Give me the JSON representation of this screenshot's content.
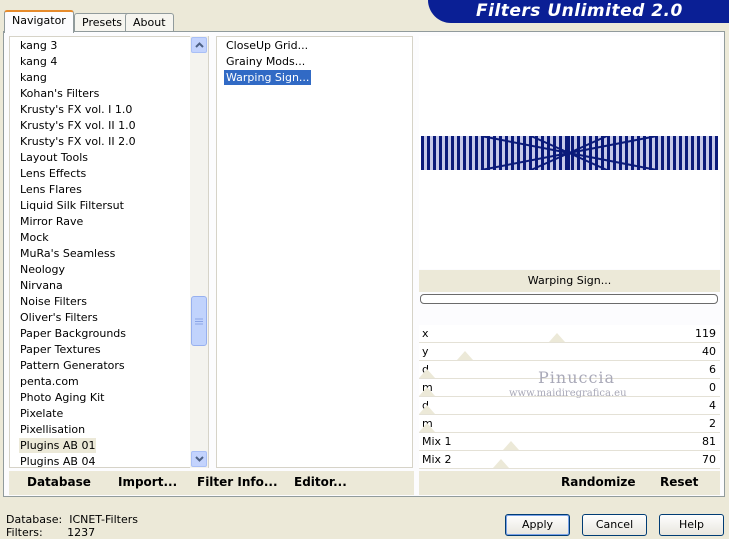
{
  "tabs": [
    "Navigator",
    "Presets",
    "About"
  ],
  "title": "Filters Unlimited 2.0",
  "categories": [
    "kang 3",
    "kang 4",
    "kang",
    "Kohan's Filters",
    "Krusty's FX vol. I 1.0",
    "Krusty's FX vol. II 1.0",
    "Krusty's FX vol. II 2.0",
    "Layout Tools",
    "Lens Effects",
    "Lens Flares",
    "Liquid Silk Filtersut",
    "Mirror Rave",
    "Mock",
    "MuRa's Seamless",
    "Neology",
    "Nirvana",
    "Noise Filters",
    "Oliver's Filters",
    "Paper Backgrounds",
    "Paper Textures",
    "Pattern Generators",
    "penta.com",
    "Photo Aging Kit",
    "Pixelate",
    "Pixellisation",
    "Plugins AB 01",
    "Plugins AB 04"
  ],
  "selected_category": "Plugins AB 01",
  "filters": [
    "CloseUp Grid...",
    "Grainy Mods...",
    "Warping Sign..."
  ],
  "selected_filter": "Warping Sign...",
  "current_filter_name": "Warping Sign...",
  "params": [
    {
      "label": "x",
      "value": "119"
    },
    {
      "label": "y",
      "value": "40"
    },
    {
      "label": "d",
      "value": "6"
    },
    {
      "label": "m",
      "value": "0"
    },
    {
      "label": "d",
      "value": "4"
    },
    {
      "label": "m",
      "value": "2"
    },
    {
      "label": "Mix 1",
      "value": "81"
    },
    {
      "label": "Mix 2",
      "value": "70"
    }
  ],
  "watermark": {
    "line1": "Pinuccia",
    "line2": "www.maidiregrafica.eu"
  },
  "toolbar_left": {
    "database": "Database",
    "import": "Import...",
    "filter_info": "Filter Info...",
    "editor": "Editor..."
  },
  "toolbar_right": {
    "randomize": "Randomize",
    "reset": "Reset"
  },
  "status": {
    "database_label": "Database:",
    "database_value": "ICNET-Filters",
    "filters_label": "Filters:",
    "filters_value": "1237"
  },
  "buttons": {
    "apply": "Apply",
    "cancel": "Cancel",
    "help": "Help"
  },
  "colors": {
    "banner": "#0a1f95",
    "selection": "#316ac5",
    "background": "#ece9d8"
  }
}
